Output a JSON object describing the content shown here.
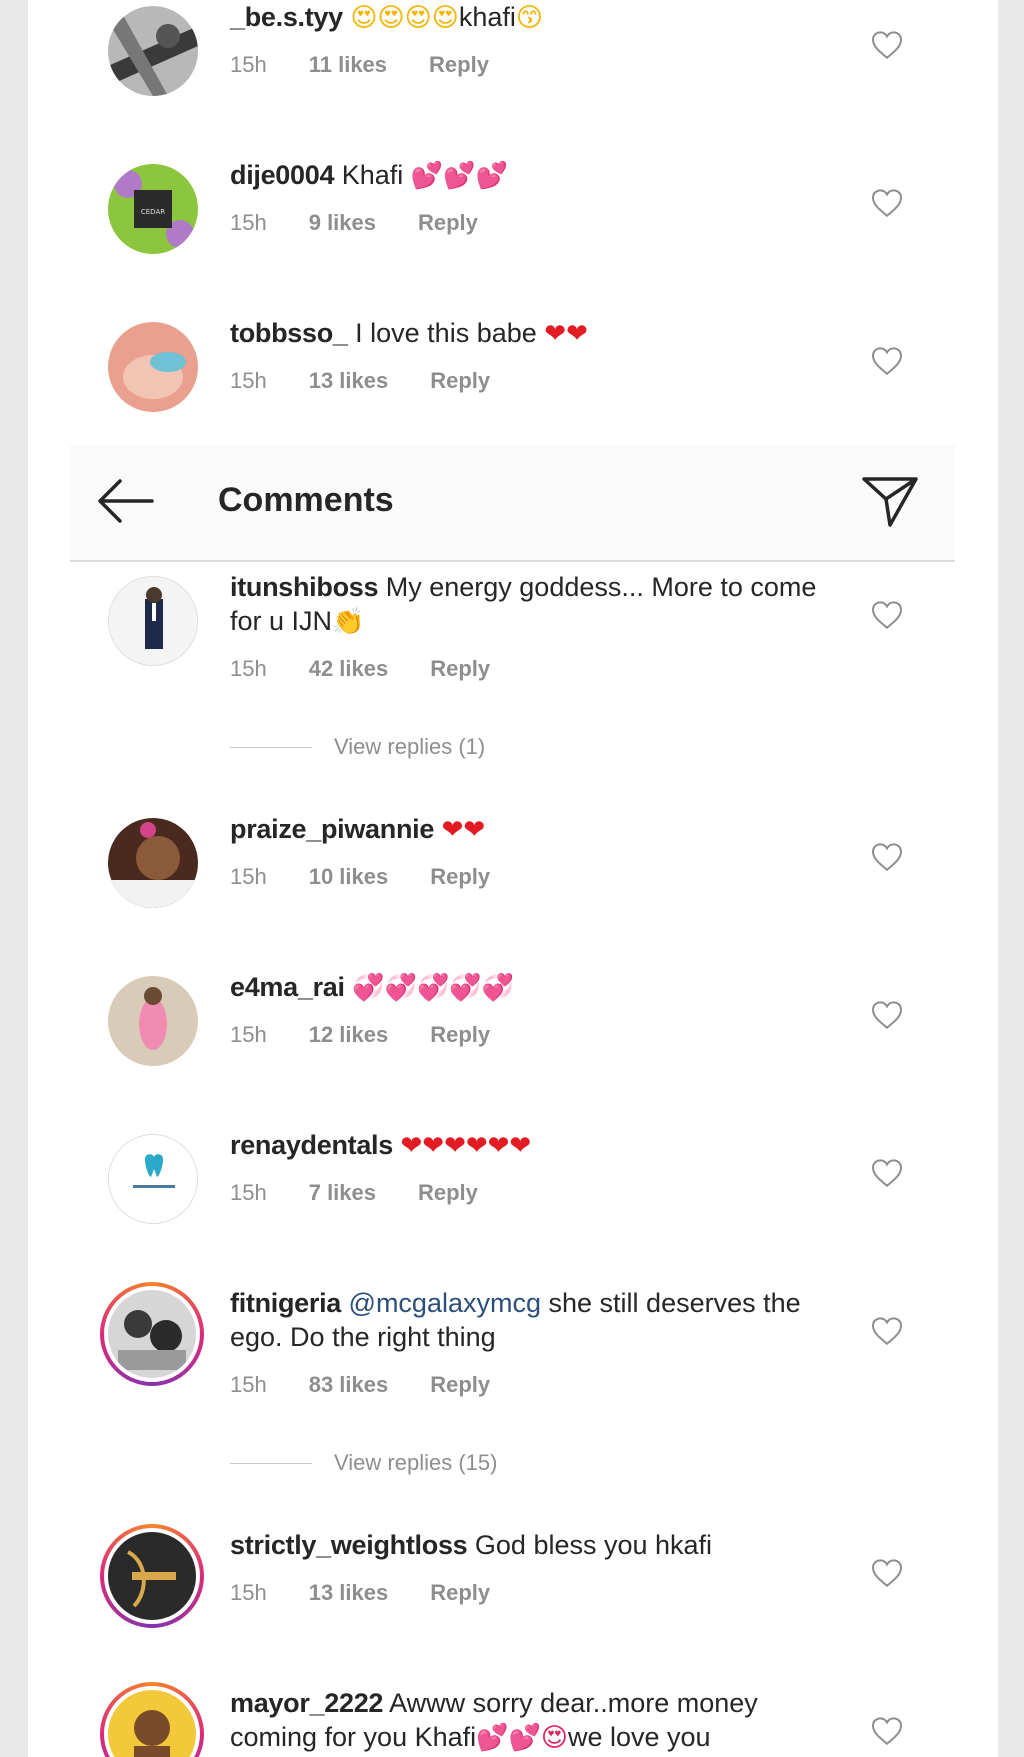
{
  "header": {
    "title": "Comments"
  },
  "comments": [
    {
      "username": "_be.s.tyy",
      "text_prefix": "",
      "mention": "",
      "text": "",
      "emojis": "😍😍😍😍",
      "text_after": "khafi",
      "emoji_after": "😙",
      "age": "15h",
      "likes": "11 likes",
      "reply": "Reply",
      "view_replies": ""
    },
    {
      "username": "dije0004",
      "text": "Khafi",
      "emojis": "💕💕💕",
      "age": "15h",
      "likes": "9 likes",
      "reply": "Reply",
      "view_replies": ""
    },
    {
      "username": "tobbsso_",
      "text": "I love this babe",
      "emojis": "❤❤",
      "age": "15h",
      "likes": "13 likes",
      "reply": "Reply",
      "view_replies": ""
    },
    {
      "username": "itunshiboss",
      "text": "My energy goddess... More to come for u IJN",
      "emojis": "👏",
      "age": "15h",
      "likes": "42 likes",
      "reply": "Reply",
      "view_replies": "View replies (1)"
    },
    {
      "username": "praize_piwannie",
      "text": "",
      "emojis": "❤❤",
      "age": "15h",
      "likes": "10 likes",
      "reply": "Reply",
      "view_replies": ""
    },
    {
      "username": "e4ma_rai",
      "text": "",
      "emojis": "💞💞💞💞💞",
      "age": "15h",
      "likes": "12 likes",
      "reply": "Reply",
      "view_replies": ""
    },
    {
      "username": "renaydentals",
      "text": "",
      "emojis": "❤❤❤❤❤❤",
      "age": "15h",
      "likes": "7 likes",
      "reply": "Reply",
      "view_replies": ""
    },
    {
      "username": "fitnigeria",
      "mention": "@mcgalaxymcg",
      "text": "she still deserves the ego. Do the right thing",
      "emojis": "",
      "age": "15h",
      "likes": "83 likes",
      "reply": "Reply",
      "view_replies": "View replies (15)"
    },
    {
      "username": "strictly_weightloss",
      "text": "God bless you hkafi",
      "emojis": "",
      "age": "15h",
      "likes": "13 likes",
      "reply": "Reply",
      "view_replies": ""
    },
    {
      "username": "mayor_2222",
      "text": "Awww sorry dear..more money coming for you Khafi",
      "emojis": "💕💕😍",
      "text_after": "we love you",
      "age": "",
      "likes": "",
      "reply": "",
      "view_replies": ""
    }
  ],
  "icons": {
    "heart": "heart-outline-icon",
    "back": "arrow-left-icon",
    "send": "paper-plane-icon"
  },
  "colors": {
    "mention": "#2b4f7a",
    "meta": "#8e8e8e",
    "text": "#262626"
  }
}
